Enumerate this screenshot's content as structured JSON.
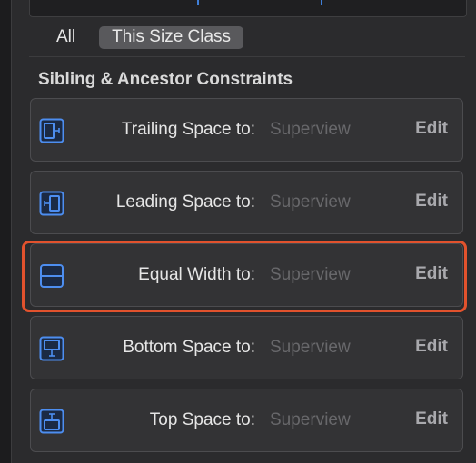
{
  "filter": {
    "all_label": "All",
    "size_class_label": "This Size Class"
  },
  "section": {
    "title": "Sibling & Ancestor Constraints"
  },
  "constraints": [
    {
      "label": "Trailing Space to:",
      "target": "Superview",
      "edit": "Edit",
      "icon": "trailing-space-icon"
    },
    {
      "label": "Leading Space to:",
      "target": "Superview",
      "edit": "Edit",
      "icon": "leading-space-icon"
    },
    {
      "label": "Equal Width to:",
      "target": "Superview",
      "edit": "Edit",
      "icon": "equal-width-icon"
    },
    {
      "label": "Bottom Space to:",
      "target": "Superview",
      "edit": "Edit",
      "icon": "bottom-space-icon"
    },
    {
      "label": "Top Space to:",
      "target": "Superview",
      "edit": "Edit",
      "icon": "top-space-icon"
    }
  ],
  "colors": {
    "background": "#2b2b2d",
    "card": "#333335",
    "accent_blue": "#3f7fd9",
    "highlight": "#e2522d"
  }
}
